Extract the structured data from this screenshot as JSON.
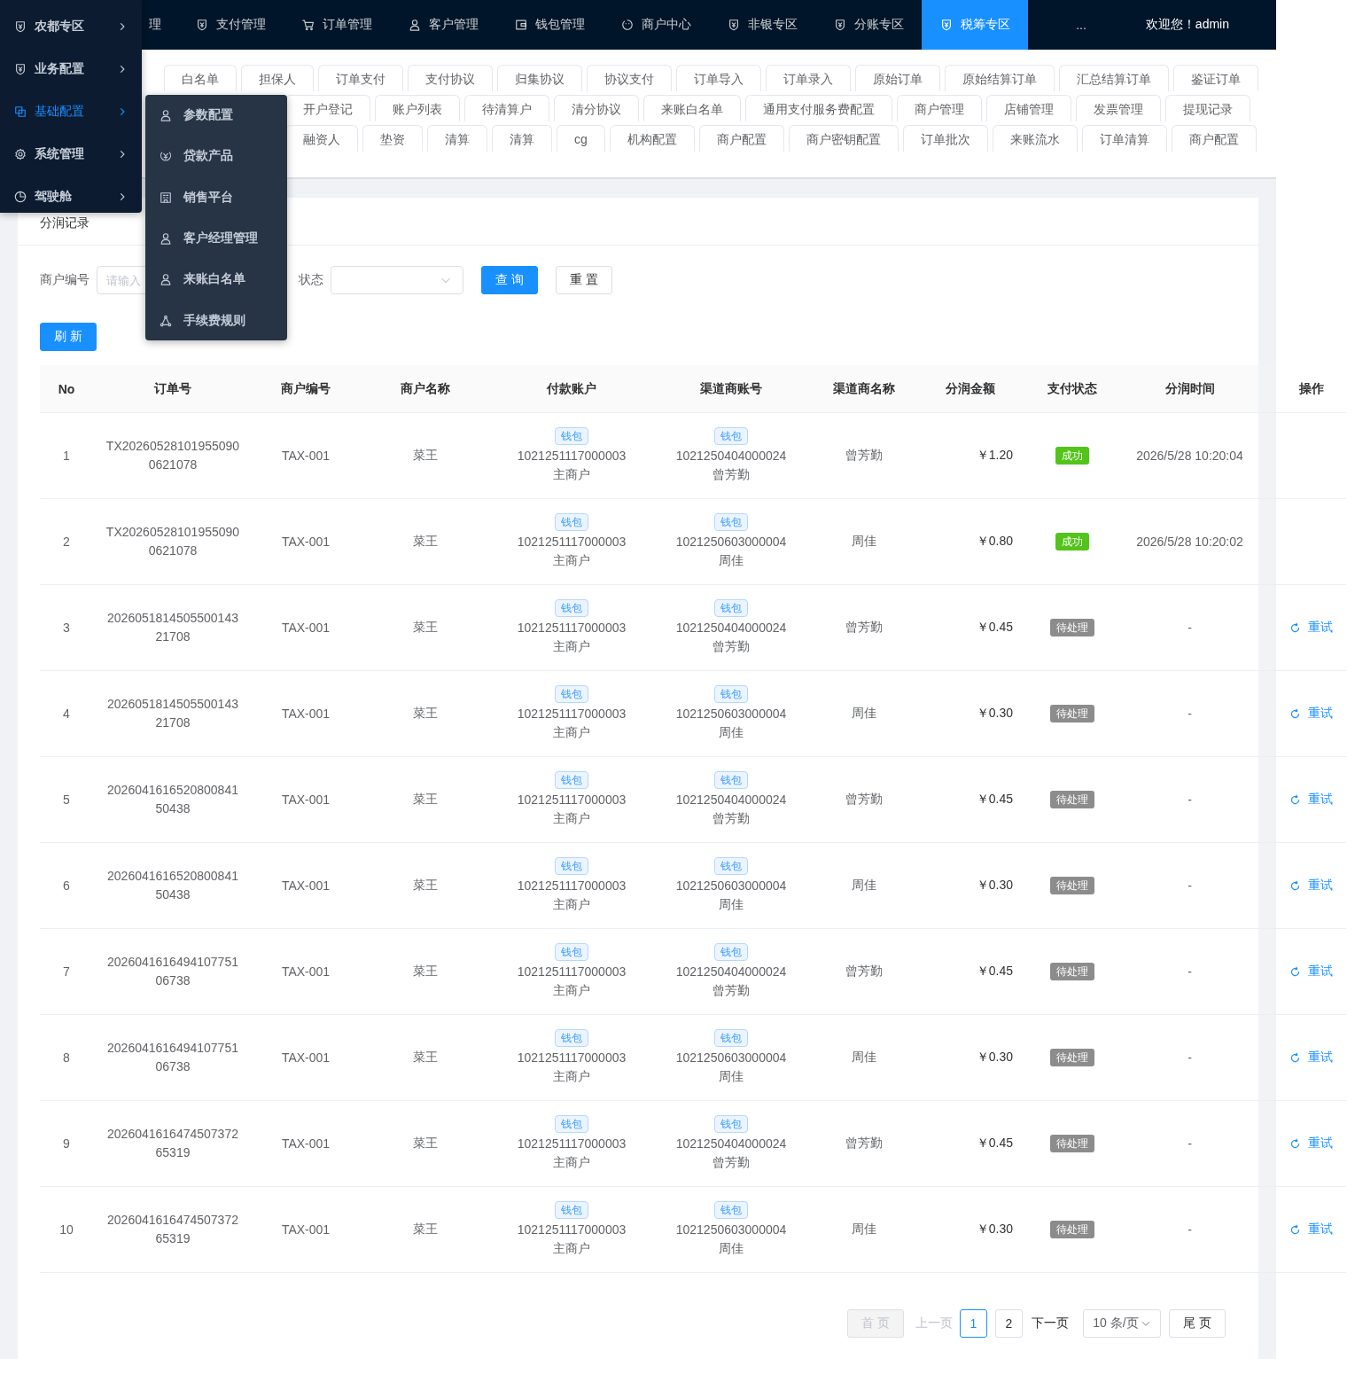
{
  "nav": {
    "items": [
      {
        "label": "理",
        "selected": false
      },
      {
        "label": "支付管理",
        "selected": false
      },
      {
        "label": "订单管理",
        "selected": false
      },
      {
        "label": "客户管理",
        "selected": false
      },
      {
        "label": "钱包管理",
        "selected": false
      },
      {
        "label": "商户中心",
        "selected": false
      },
      {
        "label": "非银专区",
        "selected": false
      },
      {
        "label": "分账专区",
        "selected": false
      },
      {
        "label": "税筹专区",
        "selected": true
      },
      {
        "label": "...",
        "selected": false
      }
    ],
    "welcome": "欢迎您！admin"
  },
  "tabs": [
    [
      {
        "label": "白名单",
        "selected": false
      },
      {
        "label": "担保人",
        "selected": false
      },
      {
        "label": "订单支付",
        "selected": false
      },
      {
        "label": "支付协议",
        "selected": false
      },
      {
        "label": "归集协议",
        "selected": false
      },
      {
        "label": "协议支付",
        "selected": false
      },
      {
        "label": "订单导入",
        "selected": false
      },
      {
        "label": "订单录入",
        "selected": false
      },
      {
        "label": "原始订单",
        "selected": false
      },
      {
        "label": "原始结算订单",
        "selected": false
      },
      {
        "label": "汇总结算订单",
        "selected": false
      },
      {
        "label": "鉴证订单",
        "selected": false
      }
    ],
    [
      {
        "label": "开户登记",
        "selected": false
      },
      {
        "label": "账户列表",
        "selected": false
      },
      {
        "label": "待清算户",
        "selected": false
      },
      {
        "label": "清分协议",
        "selected": false
      },
      {
        "label": "来账白名单",
        "selected": false
      },
      {
        "label": "通用支付服务费配置",
        "selected": false
      },
      {
        "label": "商户管理",
        "selected": false
      },
      {
        "label": "店铺管理",
        "selected": false
      },
      {
        "label": "发票管理",
        "selected": false
      },
      {
        "label": "提现记录",
        "selected": false
      }
    ],
    [
      {
        "label": "融资人",
        "selected": false
      },
      {
        "label": "垫资",
        "selected": false
      },
      {
        "label": "清算",
        "selected": false
      },
      {
        "label": "清算",
        "selected": false
      },
      {
        "label": "cg",
        "selected": false
      },
      {
        "label": "机构配置",
        "selected": false
      },
      {
        "label": "商户配置",
        "selected": false
      },
      {
        "label": "商户密钥配置",
        "selected": false
      },
      {
        "label": "订单批次",
        "selected": false
      },
      {
        "label": "来账流水",
        "selected": false
      },
      {
        "label": "订单清算",
        "selected": false
      },
      {
        "label": "商户配置",
        "selected": false
      }
    ]
  ],
  "side_menu": {
    "items": [
      {
        "label": "农都专区",
        "selected": false
      },
      {
        "label": "业务配置",
        "selected": false
      },
      {
        "label": "基础配置",
        "selected": true
      },
      {
        "label": "系统管理",
        "selected": false
      },
      {
        "label": "驾驶舱",
        "selected": false
      }
    ]
  },
  "submenu": {
    "items": [
      "参数配置",
      "贷款产品",
      "销售平台",
      "客户经理管理",
      "来账白名单",
      "手续费规则"
    ]
  },
  "card": {
    "title": "分润记录"
  },
  "filter": {
    "merchant_no": {
      "label": "商户编号",
      "placeholder": "请输入"
    },
    "status": {
      "label": "状态"
    },
    "buttons": [
      {
        "label": "查询",
        "kind": "primary"
      },
      {
        "label": "重置",
        "kind": "default"
      }
    ],
    "refresh": "刷新"
  },
  "table": {
    "columns": [
      "No",
      "订单号",
      "商户编号",
      "商户名称",
      "付款账户",
      "渠道商账号",
      "渠道商名称",
      "分润金额",
      "支付状态",
      "分润时间",
      "操作"
    ],
    "rows": [
      {
        "no": "1",
        "order_no": "TX202605281019550900621078",
        "merchant_no": "TAX-001",
        "merchant_name": "菜王",
        "payer": {
          "tag": "钱包",
          "account": "1021251117000003",
          "name": "主商户"
        },
        "channel": {
          "tag": "钱包",
          "account": "1021250404000024",
          "name": "曾芳勤"
        },
        "channel_name": "曾芳勤",
        "amount": "￥1.20",
        "status": {
          "label": "成功",
          "kind": "success"
        },
        "time": "2026/5/28 10:20:04"
      },
      {
        "no": "2",
        "order_no": "TX202605281019550900621078",
        "merchant_no": "TAX-001",
        "merchant_name": "菜王",
        "payer": {
          "tag": "钱包",
          "account": "1021251117000003",
          "name": "主商户"
        },
        "channel": {
          "tag": "钱包",
          "account": "1021250603000004",
          "name": "周佳"
        },
        "channel_name": "周佳",
        "amount": "￥0.80",
        "status": {
          "label": "成功",
          "kind": "success"
        },
        "time": "2026/5/28 10:20:02"
      },
      {
        "no": "3",
        "order_no": "202605181450550014321708",
        "merchant_no": "TAX-001",
        "merchant_name": "菜王",
        "payer": {
          "tag": "钱包",
          "account": "1021251117000003",
          "name": "主商户"
        },
        "channel": {
          "tag": "钱包",
          "account": "1021250404000024",
          "name": "曾芳勤"
        },
        "channel_name": "曾芳勤",
        "amount": "￥0.45",
        "status": {
          "label": "待处理",
          "kind": "pending"
        },
        "time": "-",
        "action": "重试"
      },
      {
        "no": "4",
        "order_no": "202605181450550014321708",
        "merchant_no": "TAX-001",
        "merchant_name": "菜王",
        "payer": {
          "tag": "钱包",
          "account": "1021251117000003",
          "name": "主商户"
        },
        "channel": {
          "tag": "钱包",
          "account": "1021250603000004",
          "name": "周佳"
        },
        "channel_name": "周佳",
        "amount": "￥0.30",
        "status": {
          "label": "待处理",
          "kind": "pending"
        },
        "time": "-",
        "action": "重试"
      },
      {
        "no": "5",
        "order_no": "202604161652080084150438",
        "merchant_no": "TAX-001",
        "merchant_name": "菜王",
        "payer": {
          "tag": "钱包",
          "account": "1021251117000003",
          "name": "主商户"
        },
        "channel": {
          "tag": "钱包",
          "account": "1021250404000024",
          "name": "曾芳勤"
        },
        "channel_name": "曾芳勤",
        "amount": "￥0.45",
        "status": {
          "label": "待处理",
          "kind": "pending"
        },
        "time": "-",
        "action": "重试"
      },
      {
        "no": "6",
        "order_no": "202604161652080084150438",
        "merchant_no": "TAX-001",
        "merchant_name": "菜王",
        "payer": {
          "tag": "钱包",
          "account": "1021251117000003",
          "name": "主商户"
        },
        "channel": {
          "tag": "钱包",
          "account": "1021250603000004",
          "name": "周佳"
        },
        "channel_name": "周佳",
        "amount": "￥0.30",
        "status": {
          "label": "待处理",
          "kind": "pending"
        },
        "time": "-",
        "action": "重试"
      },
      {
        "no": "7",
        "order_no": "202604161649410775106738",
        "merchant_no": "TAX-001",
        "merchant_name": "菜王",
        "payer": {
          "tag": "钱包",
          "account": "1021251117000003",
          "name": "主商户"
        },
        "channel": {
          "tag": "钱包",
          "account": "1021250404000024",
          "name": "曾芳勤"
        },
        "channel_name": "曾芳勤",
        "amount": "￥0.45",
        "status": {
          "label": "待处理",
          "kind": "pending"
        },
        "time": "-",
        "action": "重试"
      },
      {
        "no": "8",
        "order_no": "202604161649410775106738",
        "merchant_no": "TAX-001",
        "merchant_name": "菜王",
        "payer": {
          "tag": "钱包",
          "account": "1021251117000003",
          "name": "主商户"
        },
        "channel": {
          "tag": "钱包",
          "account": "1021250603000004",
          "name": "周佳"
        },
        "channel_name": "周佳",
        "amount": "￥0.30",
        "status": {
          "label": "待处理",
          "kind": "pending"
        },
        "time": "-",
        "action": "重试"
      },
      {
        "no": "9",
        "order_no": "202604161647450737265319",
        "merchant_no": "TAX-001",
        "merchant_name": "菜王",
        "payer": {
          "tag": "钱包",
          "account": "1021251117000003",
          "name": "主商户"
        },
        "channel": {
          "tag": "钱包",
          "account": "1021250404000024",
          "name": "曾芳勤"
        },
        "channel_name": "曾芳勤",
        "amount": "￥0.45",
        "status": {
          "label": "待处理",
          "kind": "pending"
        },
        "time": "-",
        "action": "重试"
      },
      {
        "no": "10",
        "order_no": "202604161647450737265319",
        "merchant_no": "TAX-001",
        "merchant_name": "菜王",
        "payer": {
          "tag": "钱包",
          "account": "1021251117000003",
          "name": "主商户"
        },
        "channel": {
          "tag": "钱包",
          "account": "1021250603000004",
          "name": "周佳"
        },
        "channel_name": "周佳",
        "amount": "￥0.30",
        "status": {
          "label": "待处理",
          "kind": "pending"
        },
        "time": "-",
        "action": "重试"
      }
    ]
  },
  "pager": {
    "first": {
      "label": "首页",
      "disabled": true
    },
    "prev": {
      "label": "上一页",
      "disabled": true
    },
    "pages": [
      {
        "label": "1",
        "selected": true
      },
      {
        "label": "2",
        "selected": false
      }
    ],
    "next": {
      "label": "下一页",
      "disabled": false
    },
    "page_size": "10 条/页",
    "last": {
      "label": "尾页",
      "disabled": false
    }
  }
}
